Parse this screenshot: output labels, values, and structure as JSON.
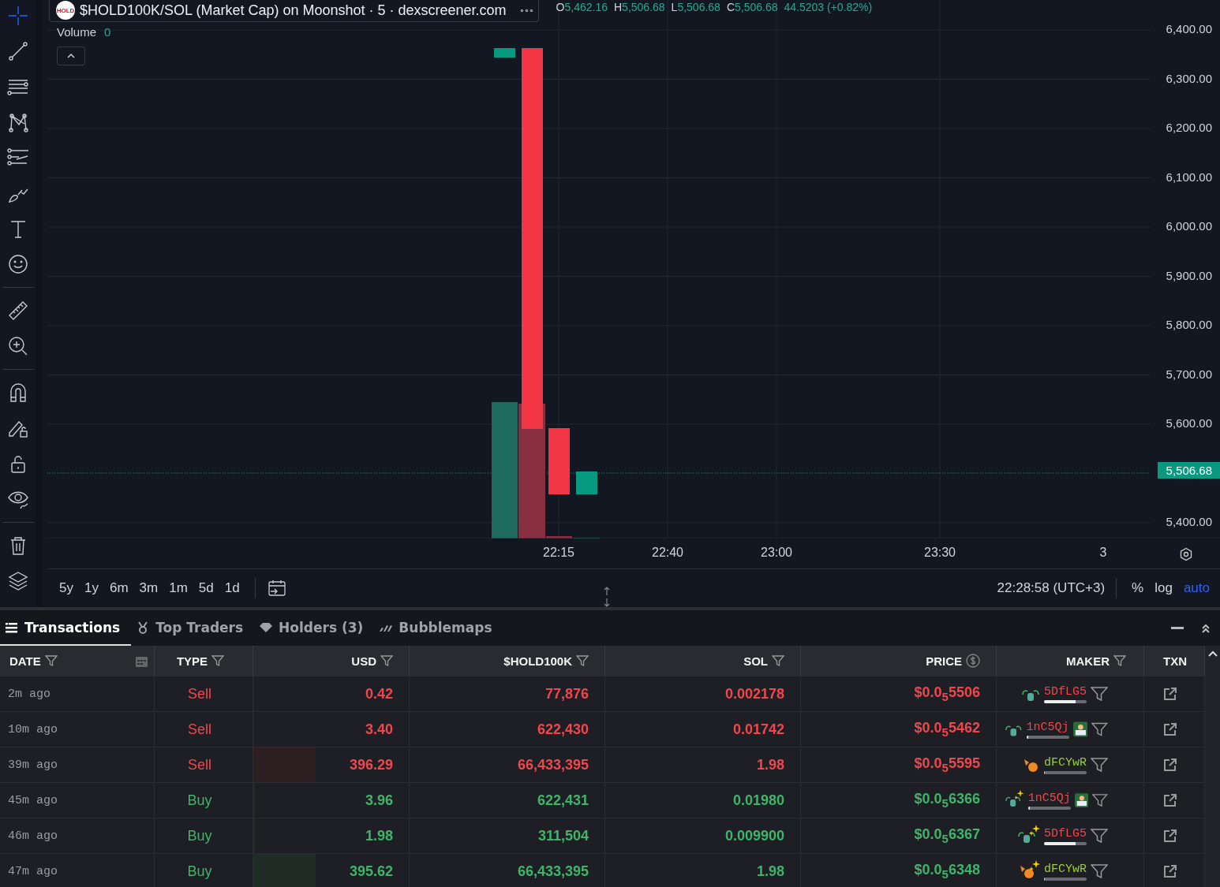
{
  "tools": [
    {
      "selected": true
    },
    {
      "selected": false
    },
    {
      "selected": false
    },
    {
      "selected": false
    },
    {
      "selected": false
    },
    {
      "selected": false
    },
    {
      "selected": false
    },
    {
      "selected": false
    },
    {
      "selected": false
    },
    {
      "selected": false
    },
    {
      "selected": false
    },
    {
      "selected": false
    },
    {
      "selected": false
    },
    {
      "selected": false
    },
    {
      "selected": false
    },
    {
      "selected": false
    }
  ],
  "chart": {
    "title": "$HOLD100K/SOL (Market Cap) on Moonshot · 5 · dexscreener.com",
    "logo_text": "HOLD",
    "menu": "∘∘∘",
    "ohlc": [
      {
        "key": "O",
        "value": "5,462.16"
      },
      {
        "key": "H",
        "value": "5,506.68"
      },
      {
        "key": "L",
        "value": "5,506.68"
      },
      {
        "key": "C",
        "value": "5,506.68"
      }
    ],
    "change": "44.5203 (+0.82%)",
    "volume_label": "Volume",
    "volume_value": "0",
    "price_labels": [
      "6,400.00",
      "6,300.00",
      "6,200.00",
      "6,100.00",
      "6,000.00",
      "5,900.00",
      "5,800.00",
      "5,700.00",
      "5,600.00",
      "5,400.00"
    ],
    "current_price": "5,506.68",
    "time_labels": [
      "22:15",
      "22:40",
      "23:00",
      "23:30",
      "3"
    ]
  },
  "ranges": [
    "5y",
    "1y",
    "6m",
    "3m",
    "1m",
    "5d",
    "1d"
  ],
  "clock": "22:28:58 (UTC+3)",
  "scale_options": [
    {
      "label": "%",
      "selected": false
    },
    {
      "label": "log",
      "selected": false
    },
    {
      "label": "auto",
      "selected": true
    }
  ],
  "panel_tabs": [
    {
      "label": "Transactions",
      "selected": true
    },
    {
      "label": "Top Traders",
      "selected": false
    },
    {
      "label": "Holders (3)",
      "selected": false
    },
    {
      "label": "Bubblemaps",
      "selected": false
    }
  ],
  "columns": [
    "DATE",
    "TYPE",
    "USD",
    "$HOLD100K",
    "SOL",
    "PRICE",
    "MAKER",
    "TXN"
  ],
  "rows": [
    {
      "date": "2m ago",
      "type": "Sell",
      "kind": "sell",
      "usd": {
        "text": "0.42",
        "level": 0
      },
      "token": "77,876",
      "sol": "0.002178",
      "price": "$0.0$_{5}$5506",
      "maker": {
        "name": "5DfLG5",
        "color": "#f0474f",
        "level": 0.75,
        "kind": "sprout",
        "sparkle": false,
        "avatar": false
      }
    },
    {
      "date": "10m ago",
      "type": "Sell",
      "kind": "sell",
      "usd": {
        "text": "3.40",
        "level": 0
      },
      "token": "622,430",
      "sol": "0.01742",
      "price": "$0.0$_{5}$5462",
      "maker": {
        "name": "1nC5Qj",
        "color": "#f0474f",
        "level": 0.04,
        "kind": "sprout",
        "sparkle": false,
        "avatar": true
      }
    },
    {
      "date": "39m ago",
      "type": "Sell",
      "kind": "sell",
      "usd": {
        "text": "396.29",
        "level": 0.4
      },
      "token": "66,433,395",
      "sol": "1.98",
      "price": "$0.0$_{5}$5595",
      "maker": {
        "name": "dFCYwR",
        "color": "#9ccd3c",
        "level": 0,
        "kind": "fish",
        "sparkle": false,
        "avatar": false
      }
    },
    {
      "date": "45m ago",
      "type": "Buy",
      "kind": "buy",
      "usd": {
        "text": "3.96",
        "level": 0.01
      },
      "token": "622,431",
      "sol": "0.01980",
      "price": "$0.0$_{5}$6366",
      "maker": {
        "name": "1nC5Qj",
        "color": "#f0474f",
        "level": 0.04,
        "kind": "sprout",
        "sparkle": true,
        "avatar": true
      }
    },
    {
      "date": "46m ago",
      "type": "Buy",
      "kind": "buy",
      "usd": {
        "text": "1.98",
        "level": 0.01
      },
      "token": "311,504",
      "sol": "0.009900",
      "price": "$0.0$_{5}$6367",
      "maker": {
        "name": "5DfLG5",
        "color": "#f0474f",
        "level": 0.75,
        "kind": "sprout",
        "sparkle": true,
        "avatar": false
      }
    },
    {
      "date": "47m ago",
      "type": "Buy",
      "kind": "buy",
      "usd": {
        "text": "395.62",
        "level": 0.4
      },
      "token": "66,433,395",
      "sol": "1.98",
      "price": "$0.0$_{5}$6348",
      "maker": {
        "name": "dFCYwR",
        "color": "#9ccd3c",
        "level": 0,
        "kind": "fish",
        "sparkle": true,
        "avatar": false
      }
    }
  ]
}
